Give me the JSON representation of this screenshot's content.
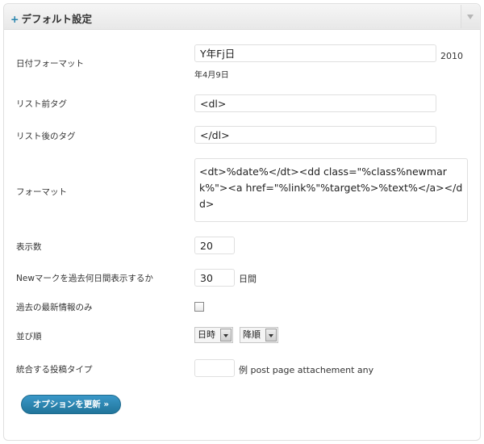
{
  "panel": {
    "title": "デフォルト設定",
    "expand_glyph": "+"
  },
  "fields": {
    "date_format": {
      "label": "日付フォーマット",
      "value": "Y年Fj日",
      "example": "2010年4月9日",
      "example_year": "2010",
      "example_rest": "年4月9日"
    },
    "list_before_tag": {
      "label": "リスト前タグ",
      "value": "<dl>"
    },
    "list_after_tag": {
      "label": "リスト後のタグ",
      "value": "</dl>"
    },
    "format": {
      "label": "フォーマット",
      "value": "<dt>%date%</dt><dd class=\"%class%newmark%\"><a href=\"%link%\"%target%>%text%</a></dd>"
    },
    "display_count": {
      "label": "表示数",
      "value": "20"
    },
    "new_mark_days": {
      "label": "Newマークを過去何日間表示するか",
      "value": "30",
      "unit": "日間"
    },
    "latest_only": {
      "label": "過去の最新情報のみ",
      "checked": false
    },
    "sort_order": {
      "label": "並び順",
      "field_selected": "日時",
      "direction_selected": "降順"
    },
    "post_type": {
      "label": "統合する投稿タイプ",
      "value": "",
      "example": "例 post page attachement any"
    }
  },
  "actions": {
    "update_label": "オプションを更新 »"
  },
  "colors": {
    "accent": "#21759b",
    "border": "#dfdfdf"
  }
}
